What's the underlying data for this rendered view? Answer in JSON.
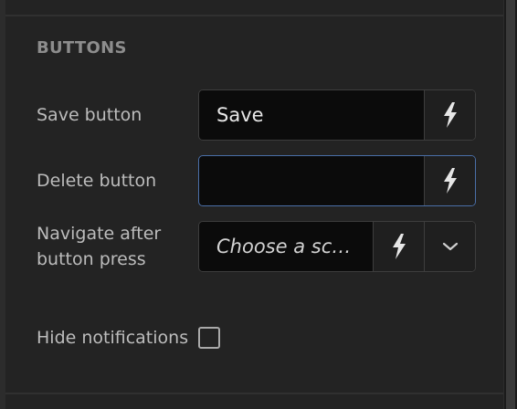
{
  "section": {
    "title": "BUTTONS"
  },
  "rows": [
    {
      "label": "Save button",
      "value": "Save"
    },
    {
      "label": "Delete button",
      "value": ""
    },
    {
      "label_line1": "Navigate after",
      "label_line2": "button press",
      "placeholder": "Choose a sc…"
    }
  ],
  "hide_notifications": {
    "label": "Hide notifications",
    "checked": false
  },
  "icons": {
    "action": "lightning-icon",
    "dropdown": "chevron-down-icon"
  },
  "colors": {
    "focus_border": "#4a6fa8",
    "panel_bg": "#232323",
    "field_bg": "#0b0b0b"
  }
}
